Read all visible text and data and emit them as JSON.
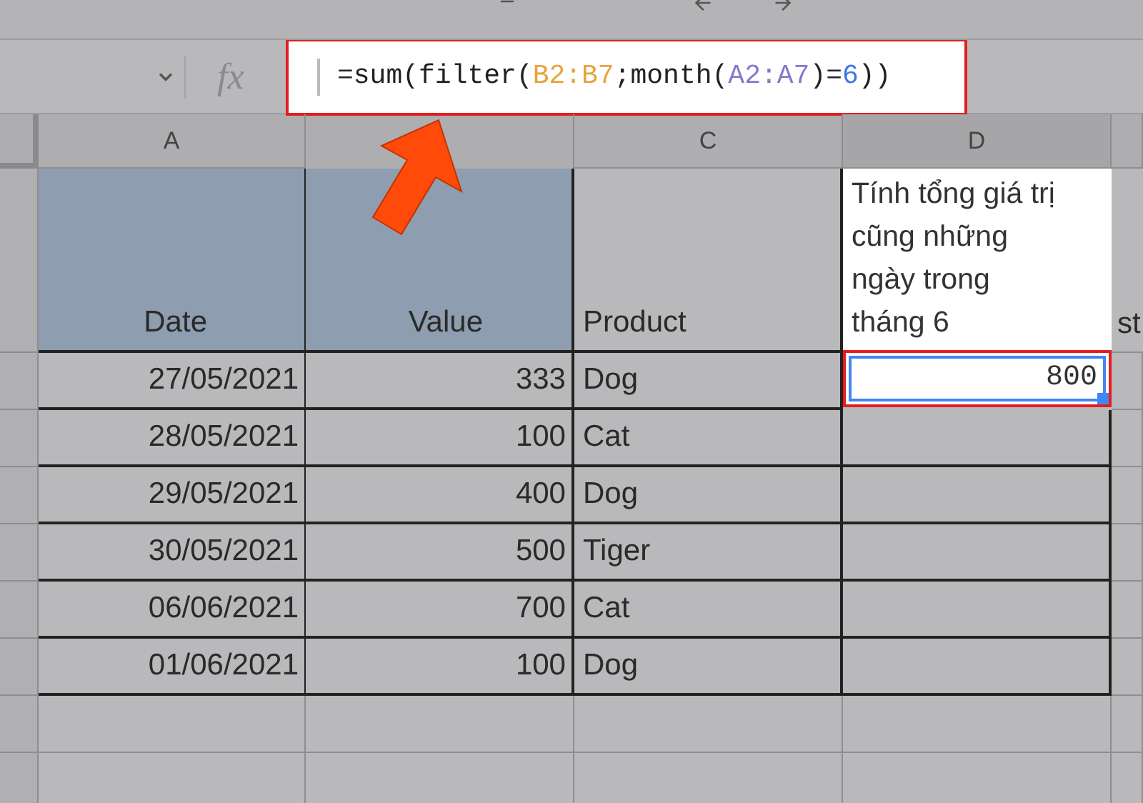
{
  "formula_bar": {
    "fx_label": "fx",
    "formula_parts": [
      {
        "text": "=sum(filter(",
        "color": "#202124"
      },
      {
        "text": "B2:B7",
        "color": "#e8a33d"
      },
      {
        "text": ";month(",
        "color": "#202124"
      },
      {
        "text": "A2:A7",
        "color": "#8a76c9"
      },
      {
        "text": ")=",
        "color": "#202124"
      },
      {
        "text": "6",
        "color": "#3b78e7"
      },
      {
        "text": "))",
        "color": "#202124"
      }
    ]
  },
  "column_headers": {
    "a": "A",
    "c": "C",
    "d": "D"
  },
  "header_row": {
    "date": "Date",
    "value": "Value",
    "product": "Product",
    "note": "Tính tổng giá trị cũng những ngày trong tháng 6",
    "column_e": "st"
  },
  "result": {
    "value": "800",
    "selected": true
  },
  "rows": [
    {
      "date": "27/05/2021",
      "value": "333",
      "product": "Dog"
    },
    {
      "date": "28/05/2021",
      "value": "100",
      "product": "Cat"
    },
    {
      "date": "29/05/2021",
      "value": "400",
      "product": "Dog"
    },
    {
      "date": "30/05/2021",
      "value": "500",
      "product": "Tiger"
    },
    {
      "date": "06/06/2021",
      "value": "700",
      "product": "Cat"
    },
    {
      "date": "01/06/2021",
      "value": "100",
      "product": "Dog"
    }
  ]
}
